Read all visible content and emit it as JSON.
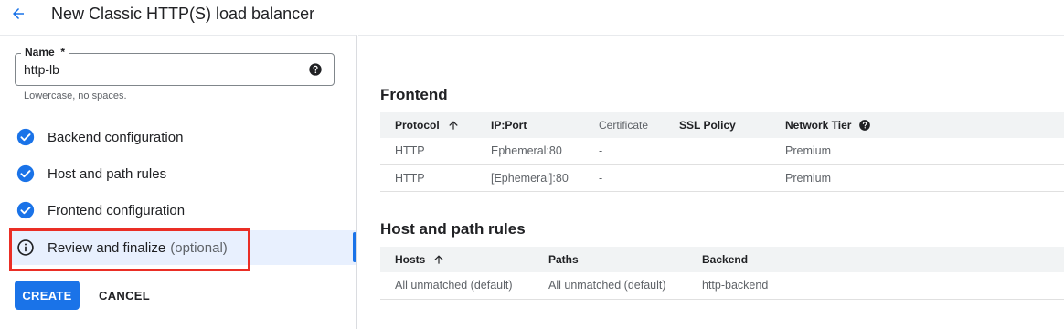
{
  "header": {
    "title": "New Classic HTTP(S) load balancer",
    "back_icon": "arrow-back-icon"
  },
  "left": {
    "name_field": {
      "label": "Name",
      "required_mark": "*",
      "value": "http-lb",
      "hint": "Lowercase, no spaces.",
      "help_icon": "help-circle-icon"
    },
    "steps": [
      {
        "label": "Backend configuration",
        "icon": "check-circle-icon",
        "status": "complete"
      },
      {
        "label": "Host and path rules",
        "icon": "check-circle-icon",
        "status": "complete"
      },
      {
        "label": "Frontend configuration",
        "icon": "check-circle-icon",
        "status": "complete"
      },
      {
        "label": "Review and finalize",
        "optional": "(optional)",
        "icon": "info-icon",
        "status": "active"
      }
    ],
    "create_label": "CREATE",
    "cancel_label": "CANCEL"
  },
  "frontend": {
    "title": "Frontend",
    "columns": [
      "Protocol",
      "IP:Port",
      "Certificate",
      "SSL Policy",
      "Network Tier"
    ],
    "rows": [
      [
        "HTTP",
        "Ephemeral:80",
        "-",
        "",
        "Premium"
      ],
      [
        "HTTP",
        "[Ephemeral]:80",
        "-",
        "",
        "Premium"
      ]
    ]
  },
  "host_rules": {
    "title": "Host and path rules",
    "columns": [
      "Hosts",
      "Paths",
      "Backend"
    ],
    "rows": [
      [
        "All unmatched (default)",
        "All unmatched (default)",
        "http-backend"
      ]
    ]
  },
  "colors": {
    "accent": "#1a73e8",
    "highlight": "#ea2e25",
    "active_step_bg": "#e8f0fe"
  }
}
